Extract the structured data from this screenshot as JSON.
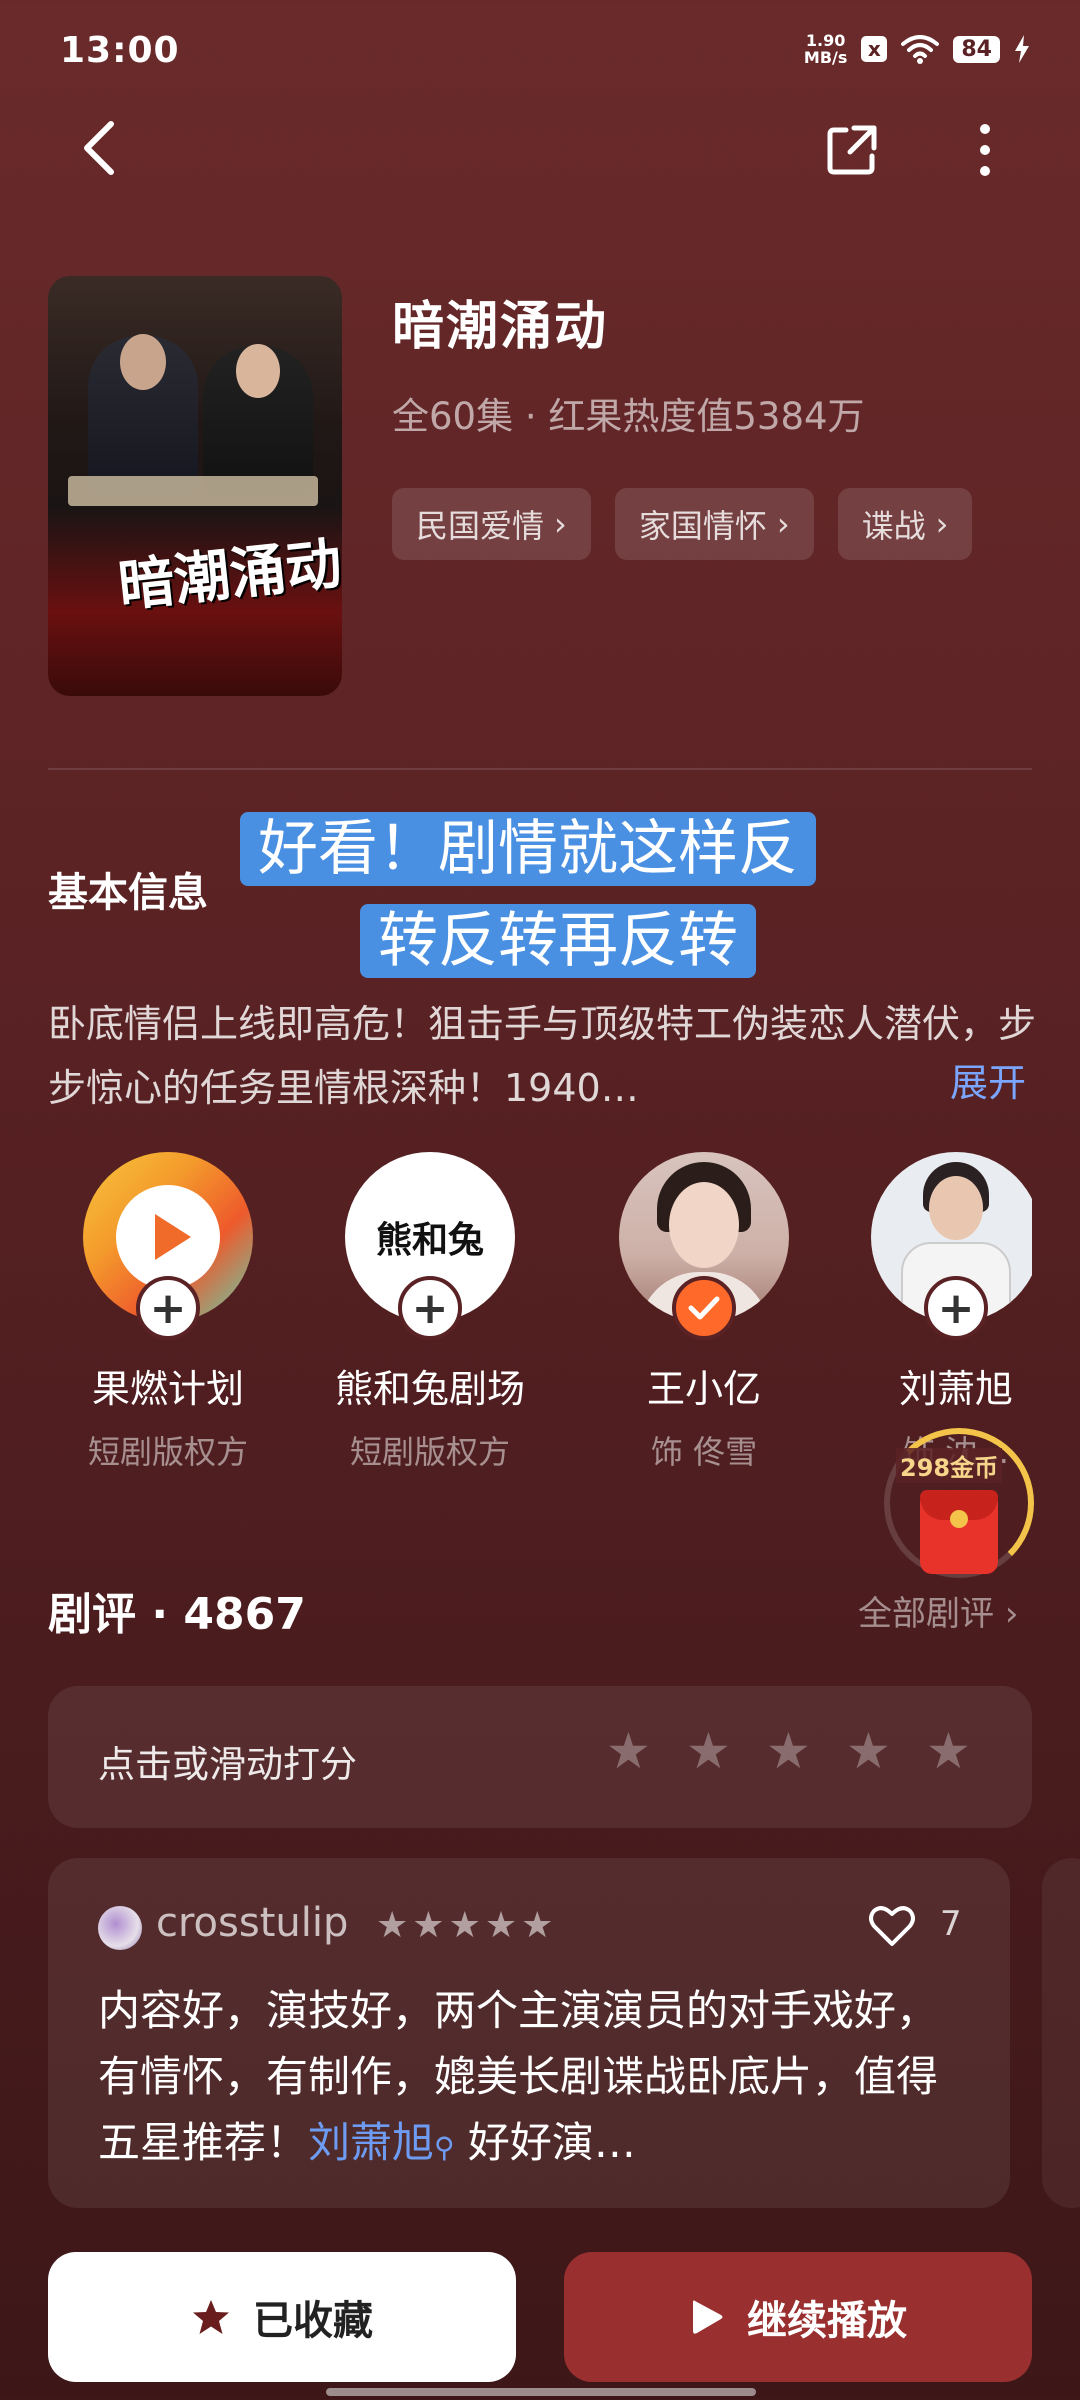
{
  "status_bar": {
    "time": "13:00",
    "net_speed_value": "1.90",
    "net_speed_unit": "MB/s",
    "battery": "84",
    "notification_badge": "x"
  },
  "show": {
    "title": "暗潮涌动",
    "meta": "全60集 · 红果热度值5384万",
    "tags": [
      "民国爱情",
      "家国情怀",
      "谍战"
    ],
    "poster_title_art": "暗潮涌动"
  },
  "basic_info": {
    "label": "基本信息",
    "overlay_caption_line1": "好看！剧情就这样反",
    "overlay_caption_line2": "转反转再反转",
    "synopsis": "卧底情侣上线即高危！狙击手与顶级特工伪装恋人潜伏，步步惊心的任务里情根深种！1940…",
    "expand_label": "展开"
  },
  "creators": [
    {
      "name": "果燃计划",
      "role": "短剧版权方",
      "followed": false,
      "icon": "play-logo-icon"
    },
    {
      "name": "熊和兔剧场",
      "role": "短剧版权方",
      "followed": false,
      "icon": "bear-rabbit-logo-icon",
      "logo_text": "熊和兔"
    },
    {
      "name": "王小亿",
      "role": "饰 佟雪",
      "followed": true,
      "icon": "actress-avatar"
    },
    {
      "name": "刘萧旭",
      "role": "饰 沈…",
      "followed": false,
      "icon": "actor-avatar"
    }
  ],
  "coin_reward": {
    "label": "298金币"
  },
  "reviews": {
    "title": "剧评 · 4867",
    "all_label": "全部剧评",
    "rating_prompt": "点击或滑动打分",
    "rating_stars": 5,
    "items": [
      {
        "user": "crosstulip",
        "stars": 5,
        "likes": "7",
        "text_before": "内容好，演技好，两个主演演员的对手戏好，有情怀，有制作，媲美长剧谍战卧底片，值得五星推荐！",
        "mention": "刘萧旭",
        "text_after": " 好好演…"
      }
    ]
  },
  "actions": {
    "collect_label": "已收藏",
    "play_label": "继续播放"
  },
  "colors": {
    "accent_orange": "#ff6a2a",
    "link_blue": "#7aa6ff",
    "play_button": "#9a2f2f",
    "background": "#5a2224"
  }
}
